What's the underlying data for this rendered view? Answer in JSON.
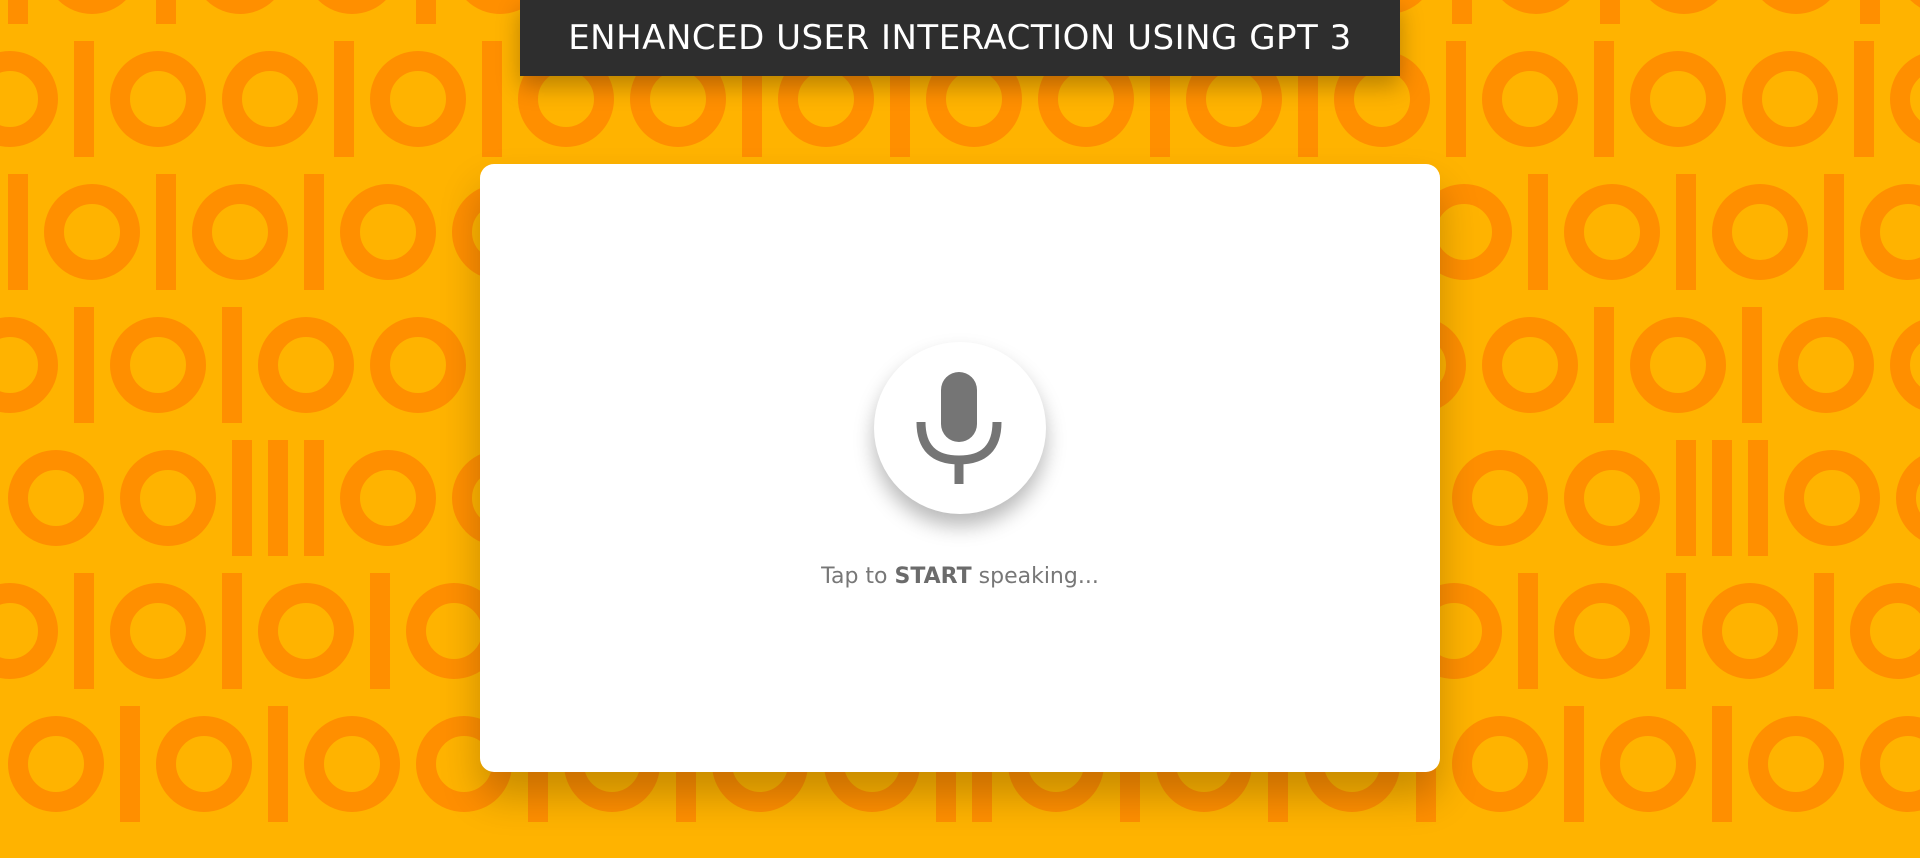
{
  "theme": {
    "background": "#FFB300",
    "pattern_color": "#FF8F00",
    "title_bar_bg": "#2e2e2e",
    "mic_color": "#757575"
  },
  "header": {
    "title": "ENHANCED USER INTERACTION USING GPT 3"
  },
  "speech_card": {
    "mic_icon": "microphone-icon",
    "prompt_prefix": "Tap to",
    "prompt_action": "START",
    "prompt_suffix": "speaking..."
  }
}
